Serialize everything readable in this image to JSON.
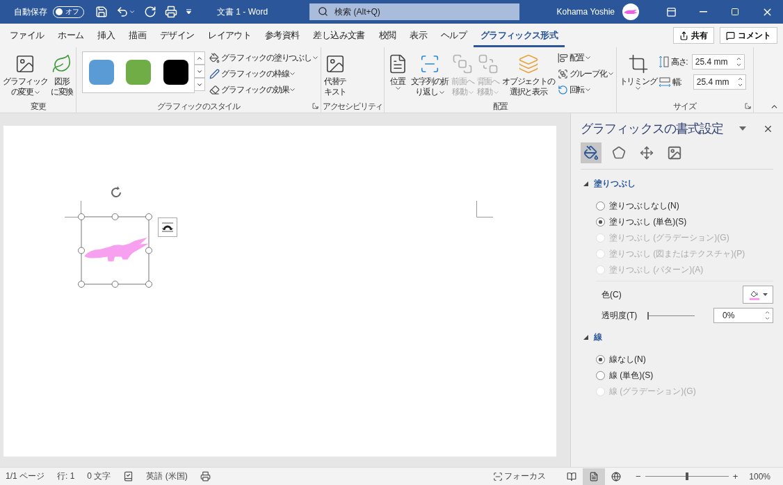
{
  "title_bar": {
    "autosave": {
      "label": "自動保存",
      "toggle": "オフ",
      "on": false
    },
    "document_title": "文書 1  -  Word",
    "search": {
      "placeholder": "検索 (Alt+Q)"
    },
    "user": "Kohama Yoshie"
  },
  "ribbon_tabs": [
    {
      "label": "ファイル",
      "selected": false
    },
    {
      "label": "ホーム",
      "selected": false
    },
    {
      "label": "挿入",
      "selected": false
    },
    {
      "label": "描画",
      "selected": false
    },
    {
      "label": "デザイン",
      "selected": false
    },
    {
      "label": "レイアウト",
      "selected": false
    },
    {
      "label": "参考資料",
      "selected": false
    },
    {
      "label": "差し込み文書",
      "selected": false
    },
    {
      "label": "校閲",
      "selected": false
    },
    {
      "label": "表示",
      "selected": false
    },
    {
      "label": "ヘルプ",
      "selected": false
    },
    {
      "label": "グラフィックス形式",
      "selected": true
    }
  ],
  "share_button": "共有",
  "comment_button": "コメント",
  "ribbon_groups": [
    {
      "label": "変更",
      "launcher": false,
      "items": [
        {
          "kind": "large",
          "lines": [
            "グラフィック",
            "の変更"
          ],
          "dropdown": true,
          "disabled": false
        },
        {
          "kind": "large",
          "lines": [
            "図形",
            "に変換"
          ],
          "dropdown": false,
          "disabled": false
        }
      ]
    },
    {
      "label": "グラフィックのスタイル",
      "launcher": true,
      "items": [
        {
          "kind": "gallery",
          "swatches": [
            {
              "color": "#5b9bd5"
            },
            {
              "color": "#70ad47"
            },
            {
              "color": "#000000"
            }
          ]
        },
        {
          "kind": "small",
          "commands": [
            {
              "label": "グラフィックの塗りつぶし",
              "dropdown": true
            },
            {
              "label": "グラフィックの枠線",
              "dropdown": true
            },
            {
              "label": "グラフィックの効果",
              "dropdown": true
            }
          ]
        }
      ]
    },
    {
      "label": "アクセシビリティ",
      "launcher": false,
      "items": [
        {
          "kind": "large",
          "lines": [
            "代替テ",
            "キスト"
          ],
          "dropdown": false,
          "disabled": false
        }
      ]
    },
    {
      "label": "配置",
      "launcher": false,
      "items": [
        {
          "kind": "large",
          "lines": [
            "位置"
          ],
          "dropdown": true,
          "disabled": false
        },
        {
          "kind": "large",
          "lines": [
            "文字列の折",
            "り返し"
          ],
          "dropdown": true,
          "disabled": false
        },
        {
          "kind": "large",
          "lines": [
            "前面へ",
            "移動"
          ],
          "dropdown": true,
          "disabled": true
        },
        {
          "kind": "large",
          "lines": [
            "背面へ",
            "移動"
          ],
          "dropdown": true,
          "disabled": true
        },
        {
          "kind": "large",
          "lines": [
            "オブジェクトの",
            "選択と表示"
          ],
          "dropdown": false,
          "disabled": false
        },
        {
          "kind": "small",
          "commands": [
            {
              "label": "配置",
              "dropdown": true
            },
            {
              "label": "グループ化",
              "dropdown": true
            },
            {
              "label": "回転",
              "dropdown": true
            }
          ]
        }
      ]
    },
    {
      "label": "サイズ",
      "launcher": true,
      "items": [
        {
          "kind": "large",
          "lines": [
            "トリミング"
          ],
          "dropdown": true,
          "disabled": false
        },
        {
          "kind": "spin",
          "fields": [
            {
              "label": "高さ:",
              "value": "25.4 mm"
            },
            {
              "label": "幅:",
              "value": "25.4 mm"
            }
          ]
        }
      ]
    }
  ],
  "format_pane": {
    "title": "グラフィックスの書式設定",
    "tabs": [
      {
        "selected": true
      },
      {
        "selected": false
      },
      {
        "selected": false
      },
      {
        "selected": false
      }
    ],
    "sections": [
      {
        "title": "塗りつぶし",
        "expanded": true,
        "options": [
          {
            "label": "塗りつぶしなし(N)",
            "selected": false,
            "disabled": false
          },
          {
            "label": "塗りつぶし (単色)(S)",
            "selected": true,
            "disabled": false
          },
          {
            "label": "塗りつぶし (グラデーション)(G)",
            "selected": false,
            "disabled": true
          },
          {
            "label": "塗りつぶし (図またはテクスチャ)(P)",
            "selected": false,
            "disabled": true
          },
          {
            "label": "塗りつぶし (パターン)(A)",
            "selected": false,
            "disabled": true
          }
        ],
        "color": {
          "label": "色(C)"
        },
        "transparency": {
          "label": "透明度(T)",
          "level": 0,
          "value": "0%"
        }
      },
      {
        "title": "線",
        "expanded": true,
        "options": [
          {
            "label": "線なし(N)",
            "selected": true,
            "disabled": false
          },
          {
            "label": "線 (単色)(S)",
            "selected": false,
            "disabled": false
          },
          {
            "label": "線 (グラデーション)(G)",
            "selected": false,
            "disabled": true
          }
        ]
      }
    ]
  },
  "status_bar": {
    "left": [
      {
        "kind": "text",
        "label": "1/1 ページ"
      },
      {
        "kind": "text",
        "label": "行: 1"
      },
      {
        "kind": "text",
        "label": "0 文字"
      },
      {
        "kind": "icon"
      },
      {
        "kind": "text",
        "label": "英語 (米国)"
      },
      {
        "kind": "icon"
      }
    ],
    "focus": "フォーカス",
    "views": [
      {
        "selected": false
      },
      {
        "selected": true
      },
      {
        "selected": false
      }
    ],
    "zoom_minus": "−",
    "zoom_plus": "+",
    "zoom": {
      "level": 0.5,
      "value": "100%"
    }
  }
}
